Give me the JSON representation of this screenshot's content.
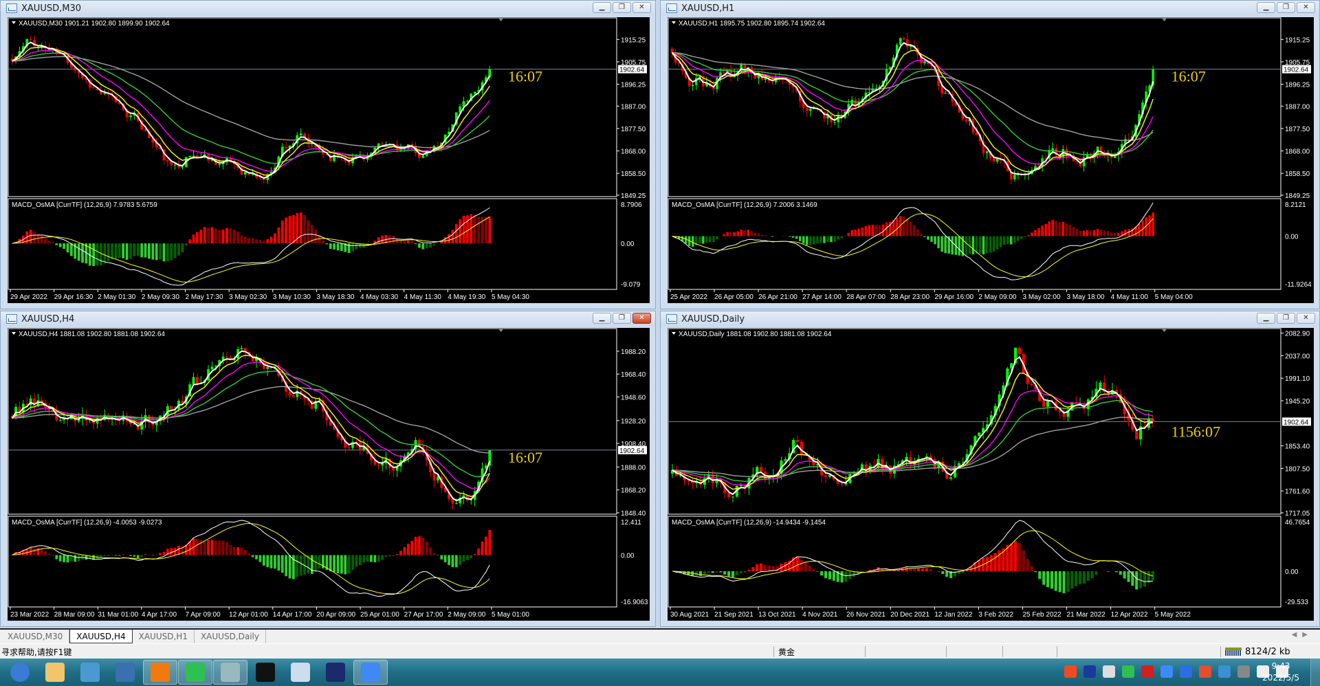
{
  "colors": {
    "bull": "#00ff00",
    "bear": "#ff0000",
    "ma_fast": "#ffffff",
    "ma_2": "#ffff00",
    "ma_3": "#ff00ff",
    "ma_4": "#32cd32",
    "ma_slow": "#a0a0a0",
    "hist_pos_up": "#ff0000",
    "hist_pos_down": "#8b0000",
    "hist_neg_down": "#32cd32",
    "hist_neg_up": "#006400",
    "countdown": "#f0d000"
  },
  "windows": [
    {
      "title": "XAUUSD,M30",
      "ohlc_header": "XAUUSD,M30  1901.21 1902.80 1899.90 1902.64",
      "indicator_label": "MACD_OsMA [CurrTF] (12,26,9) 7.9783 5.6759",
      "price_ticks": [
        "1915.25",
        "1905.75",
        "1896.25",
        "1887.00",
        "1877.50",
        "1868.00",
        "1858.50",
        "1849.25"
      ],
      "ylim": [
        1849.25,
        1923.5
      ],
      "current_price": "1902.64",
      "macd_axis": {
        "max": "8.7906",
        "zero": "0.00",
        "min": "-9.079"
      },
      "time_labels": [
        "29 Apr 2022",
        "29 Apr 16:30",
        "2 May 01:30",
        "2 May 09:30",
        "2 May 17:30",
        "3 May 02:30",
        "3 May 10:30",
        "3 May 18:30",
        "4 May 03:30",
        "4 May 11:30",
        "4 May 19:30",
        "5 May 04:30"
      ],
      "countdown": "16:07",
      "active": false,
      "close_anchors": [
        1906,
        1914,
        1912,
        1908,
        1904,
        1896,
        1890,
        1886,
        1880,
        1870,
        1860,
        1866,
        1866,
        1864,
        1862,
        1858,
        1856,
        1870,
        1874,
        1868,
        1866,
        1866,
        1866,
        1868,
        1870,
        1868,
        1866,
        1870,
        1886,
        1893,
        1902.64
      ]
    },
    {
      "title": "XAUUSD,H1",
      "ohlc_header": "XAUUSD,H1  1895.75 1902.80 1895.74 1902.64",
      "indicator_label": "MACD_OsMA [CurrTF] (12,26,9) 7.2006 3.1469",
      "price_ticks": [
        "1915.25",
        "1905.75",
        "1896.25",
        "1887.00",
        "1877.50",
        "1868.00",
        "1858.50",
        "1849.25"
      ],
      "ylim": [
        1849.25,
        1923.5
      ],
      "current_price": "1902.64",
      "macd_axis": {
        "max": "8.2121",
        "zero": "0.00",
        "min": "-11.9264"
      },
      "time_labels": [
        "25 Apr 2022",
        "26 Apr 05:00",
        "26 Apr 21:00",
        "27 Apr 14:00",
        "28 Apr 07:00",
        "28 Apr 23:00",
        "29 Apr 16:00",
        "2 May 09:00",
        "3 May 02:00",
        "3 May 18:00",
        "4 May 11:00",
        "5 May 04:00"
      ],
      "countdown": "16:07",
      "active": false,
      "close_anchors": [
        1912,
        1898,
        1896,
        1900,
        1902,
        1900,
        1896,
        1890,
        1882,
        1880,
        1886,
        1892,
        1904,
        1916,
        1908,
        1896,
        1888,
        1876,
        1862,
        1858,
        1856,
        1866,
        1868,
        1866,
        1868,
        1868,
        1880,
        1902.64
      ]
    },
    {
      "title": "XAUUSD,H4",
      "ohlc_header": "XAUUSD,H4  1881.08 1902.80 1881.08 1902.64",
      "indicator_label": "MACD_OsMA [CurrTF] (12,26,9) -4.0053 -9.0273",
      "price_ticks": [
        "1988.20",
        "1968.40",
        "1948.60",
        "1928.20",
        "1908.40",
        "1888.00",
        "1868.20",
        "1848.40"
      ],
      "ylim": [
        1848.4,
        2006
      ],
      "current_price": "1902.64",
      "macd_axis": {
        "max": "12.411",
        "zero": "0.00",
        "min": "-16.9063"
      },
      "time_labels": [
        "23 Mar 2022",
        "28 Mar 09:00",
        "31 Mar 01:00",
        "4 Apr 17:00",
        "7 Apr 09:00",
        "12 Apr 01:00",
        "14 Apr 17:00",
        "20 Apr 09:00",
        "25 Apr 01:00",
        "27 Apr 17:00",
        "2 May 09:00",
        "5 May 01:00"
      ],
      "countdown": "16:07",
      "active": true,
      "close_anchors": [
        1930,
        1948,
        1935,
        1920,
        1930,
        1932,
        1926,
        1925,
        1930,
        1945,
        1960,
        1975,
        1982,
        1990,
        1970,
        1955,
        1950,
        1940,
        1915,
        1900,
        1896,
        1888,
        1910,
        1880,
        1866,
        1868,
        1902.64
      ]
    },
    {
      "title": "XAUUSD,Daily",
      "ohlc_header": "XAUUSD,Daily  1881.08 1902.80 1881.08 1902.64",
      "indicator_label": "MACD_OsMA [CurrTF] (12,26,9) -14.9434 -9.1454",
      "price_ticks": [
        "2082.90",
        "2037.00",
        "1991.10",
        "1945.20",
        "1853.40",
        "1807.50",
        "1761.60",
        "1717.05"
      ],
      "ylim": [
        1717.05,
        2088
      ],
      "current_price": "1902.64",
      "macd_axis": {
        "max": "46.7654",
        "zero": "0.00",
        "min": "-29.533"
      },
      "time_labels": [
        "30 Aug 2021",
        "21 Sep 2021",
        "13 Oct 2021",
        "4 Nov 2021",
        "26 Nov 2021",
        "20 Dec 2021",
        "12 Jan 2022",
        "3 Feb 2022",
        "25 Feb 2022",
        "21 Mar 2022",
        "12 Apr 2022",
        "5 May 2022"
      ],
      "countdown": "1156:07",
      "active": false,
      "close_anchors": [
        1815,
        1800,
        1780,
        1760,
        1775,
        1795,
        1790,
        1860,
        1820,
        1790,
        1785,
        1800,
        1810,
        1805,
        1820,
        1830,
        1810,
        1840,
        1910,
        1950,
        2040,
        1960,
        1930,
        1935,
        1940,
        1975,
        1950,
        1880,
        1902.64
      ]
    }
  ],
  "tabs": [
    {
      "label": "XAUUSD,M30",
      "active": false
    },
    {
      "label": "XAUUSD,H4",
      "active": true
    },
    {
      "label": "XAUUSD,H1",
      "active": false
    },
    {
      "label": "XAUUSD,Daily",
      "active": false
    }
  ],
  "status": {
    "help": "寻求帮助,请按F1键",
    "profile": "黄金",
    "traffic": "8124/2 kb"
  },
  "taskbar": {
    "apps": [
      "start-orb-icon",
      "paint-icon",
      "network-user-icon",
      "desktop-icon",
      "browser-icon",
      "wechat-icon",
      "mt4-icon",
      "capcut-icon",
      "notepad-icon",
      "photoshop-icon",
      "feishu-icon"
    ],
    "tray": [
      "sogou-icon",
      "help-icon",
      "network-icon",
      "wechat-tray-icon",
      "wps-icon",
      "feishu-tray-icon",
      "security-icon",
      "speaker-icon",
      "ime-icon",
      "usb-icon",
      "volume-icon",
      "signal-icon"
    ],
    "time": "9:43",
    "date": "2022/5/5"
  }
}
